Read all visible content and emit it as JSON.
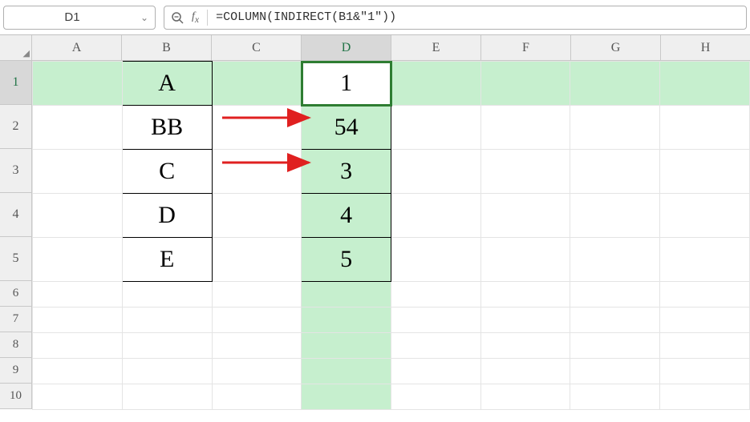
{
  "namebox": {
    "value": "D1"
  },
  "formula": {
    "text": "=COLUMN(INDIRECT(B1&\"1\"))"
  },
  "columns": [
    "A",
    "B",
    "C",
    "D",
    "E",
    "F",
    "G",
    "H"
  ],
  "rows": [
    "1",
    "2",
    "3",
    "4",
    "5",
    "6",
    "7",
    "8",
    "9",
    "10"
  ],
  "active_col": "D",
  "active_row": "1",
  "b": {
    "r1": "A",
    "r2": "BB",
    "r3": "C",
    "r4": "D",
    "r5": "E"
  },
  "d": {
    "r1": "1",
    "r2": "54",
    "r3": "3",
    "r4": "4",
    "r5": "5"
  },
  "corner_glyph": "◢"
}
